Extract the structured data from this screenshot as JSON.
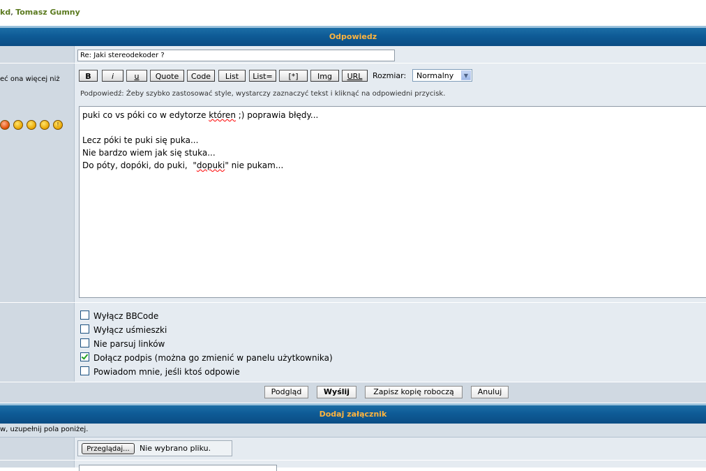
{
  "top_users": {
    "first": "kd",
    "separator": ", ",
    "second": "Tomasz Gumny"
  },
  "reply_section": {
    "title": "Odpowiedz"
  },
  "subject": {
    "value": "Re: Jaki stereodekoder ?"
  },
  "left_note": "eć ona więcej niż",
  "bbcode": {
    "buttons": [
      "B",
      "i",
      "u",
      "Quote",
      "Code",
      "List",
      "List=",
      "[*]",
      "Img",
      "URL"
    ],
    "size_label": "Rozmiar:",
    "size_value": "Normalny",
    "hint": "Podpowiedź: Żeby szybko zastosować style, wystarczy zaznaczyć tekst i kliknąć na odpowiedni przycisk."
  },
  "smilies": [
    "angry-devil",
    "evil-grin",
    "confused",
    "wink",
    "exclamation"
  ],
  "message": {
    "line1_a": "puki co vs póki co w edytorze ",
    "line1_b": "któren",
    "line1_c": " ;) poprawia błędy...",
    "line2": "Lecz póki te puki się puka...",
    "line3": "Nie bardzo wiem jak się stuka...",
    "line4_a": "Do póty, dopóki, do puki,  \"",
    "line4_b": "dopuki",
    "line4_c": "\" nie pukam..."
  },
  "options": [
    {
      "label": "Wyłącz BBCode",
      "checked": false
    },
    {
      "label": "Wyłącz uśmieszki",
      "checked": false
    },
    {
      "label": "Nie parsuj linków",
      "checked": false
    },
    {
      "label": "Dołącz podpis (można go zmienić w panelu użytkownika)",
      "checked": true
    },
    {
      "label": "Powiadom mnie, jeśli ktoś odpowie",
      "checked": false
    }
  ],
  "actions": {
    "preview": "Podgląd",
    "send": "Wyślij",
    "save_draft": "Zapisz kopię roboczą",
    "cancel": "Anuluj"
  },
  "attachment_section": {
    "title": "Dodaj załącznik",
    "note": "w, uzupełnij pola poniżej.",
    "browse_label": "Przeglądaj...",
    "no_file": "Nie wybrano pliku."
  }
}
